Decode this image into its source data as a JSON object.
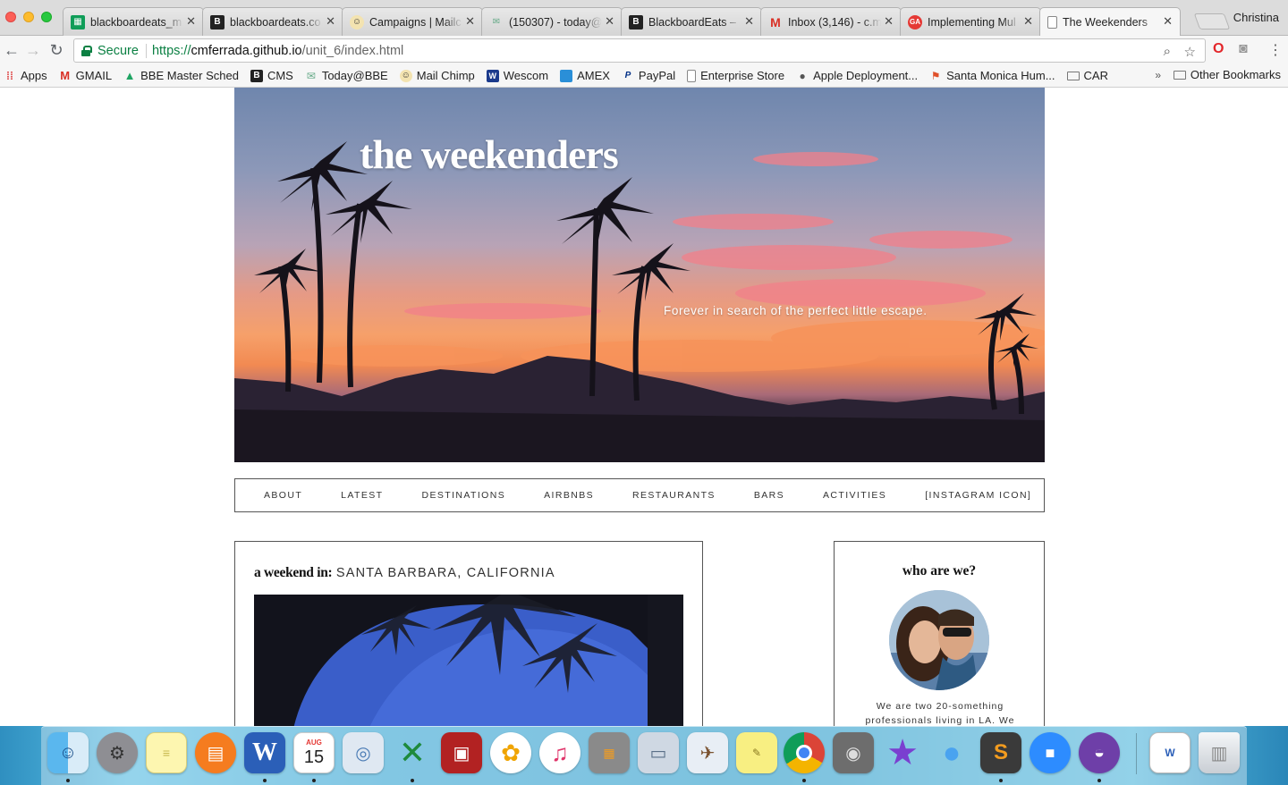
{
  "browser": {
    "tabs": [
      {
        "label": "blackboardeats_m",
        "icon": "sheets-icon",
        "active": false
      },
      {
        "label": "blackboardeats.co",
        "icon": "b-logo-icon",
        "active": false
      },
      {
        "label": "Campaigns | Mailc",
        "icon": "mailchimp-icon",
        "active": false
      },
      {
        "label": "(150307) - today@",
        "icon": "mail-icon",
        "active": false
      },
      {
        "label": "BlackboardEats –",
        "icon": "b-logo-icon",
        "active": false
      },
      {
        "label": "Inbox (3,146) - c.m",
        "icon": "gmail-icon",
        "active": false
      },
      {
        "label": "Implementing Mul",
        "icon": "ga-icon",
        "active": false
      },
      {
        "label": "The Weekenders",
        "icon": "page-icon",
        "active": true
      }
    ],
    "profile_name": "Christina",
    "address": {
      "secure_label": "Secure",
      "url_proto": "https://",
      "url_host": "cmferrada.github.io",
      "url_path": "/unit_6/index.html"
    },
    "bookmarks": [
      {
        "label": "Apps",
        "icon": "apps-grid-icon"
      },
      {
        "label": "GMAIL",
        "icon": "gmail-icon"
      },
      {
        "label": "BBE Master Sched",
        "icon": "drive-icon"
      },
      {
        "label": "CMS",
        "icon": "b-logo-icon"
      },
      {
        "label": "Today@BBE",
        "icon": "mail-icon"
      },
      {
        "label": "Mail Chimp",
        "icon": "mailchimp-icon"
      },
      {
        "label": "Wescom",
        "icon": "wescom-icon"
      },
      {
        "label": "AMEX",
        "icon": "amex-icon"
      },
      {
        "label": "PayPal",
        "icon": "paypal-icon"
      },
      {
        "label": "Enterprise Store",
        "icon": "page-icon"
      },
      {
        "label": "Apple Deployment...",
        "icon": "apple-icon"
      },
      {
        "label": "Santa Monica Hum...",
        "icon": "flag-icon"
      },
      {
        "label": "CAR",
        "icon": "folder-icon"
      }
    ],
    "bookmarks_more": "»",
    "other_bookmarks": "Other Bookmarks"
  },
  "page": {
    "site_title": "the weekenders",
    "tagline": "Forever in search of the perfect little escape.",
    "nav": [
      "ABOUT",
      "LATEST",
      "DESTINATIONS",
      "AIRBNBS",
      "RESTAURANTS",
      "BARS",
      "ACTIVITIES",
      "[INSTAGRAM ICON]"
    ],
    "post": {
      "heading_prefix": "a weekend in:",
      "destination": "SANTA BARBARA, CALIFORNIA"
    },
    "sidebar": {
      "title": "who are we?",
      "text": "We are two 20-something professionals living in LA. We"
    }
  },
  "dock": {
    "calendar_month": "AUG",
    "calendar_day": "15",
    "items": [
      "finder-icon",
      "system-preferences-icon",
      "notes-icon",
      "ibooks-icon",
      "word-icon",
      "calendar-icon",
      "preview-icon",
      "excel-icon",
      "photo-booth-icon",
      "photos-icon",
      "itunes-icon",
      "calculator-icon",
      "image-capture-icon",
      "mail-stamp-icon",
      "stickies-icon",
      "chrome-icon",
      "screenshot-icon",
      "imovie-icon",
      "messages-icon",
      "sublime-text-icon",
      "zoom-icon",
      "github-desktop-icon",
      "document-icon",
      "trash-icon"
    ]
  }
}
